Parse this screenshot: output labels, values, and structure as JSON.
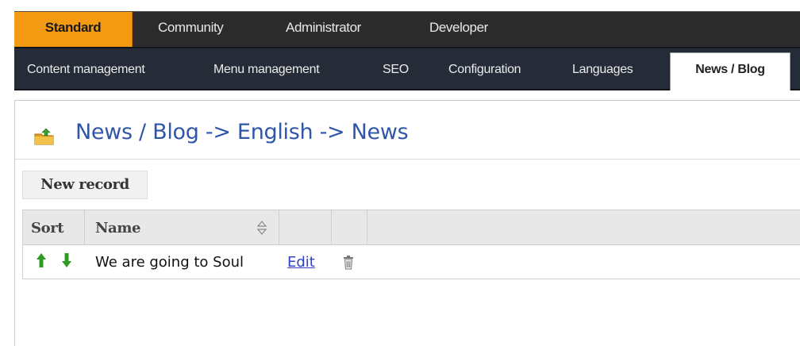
{
  "top_nav": {
    "tabs": [
      {
        "label": "Standard",
        "active": true
      },
      {
        "label": "Community",
        "active": false
      },
      {
        "label": "Administrator",
        "active": false
      },
      {
        "label": "Developer",
        "active": false
      }
    ]
  },
  "sub_nav": {
    "tabs": [
      {
        "label": "Content management",
        "active": false
      },
      {
        "label": "Menu management",
        "active": false
      },
      {
        "label": "SEO",
        "active": false
      },
      {
        "label": "Configuration",
        "active": false
      },
      {
        "label": "Languages",
        "active": false
      },
      {
        "label": "News / Blog",
        "active": true
      }
    ]
  },
  "page": {
    "title": "News / Blog -> English -> News",
    "title_icon": "folder-up-icon"
  },
  "toolbar": {
    "new_record_label": "New record"
  },
  "grid": {
    "columns": [
      "Sort",
      "Name",
      "",
      ""
    ],
    "rows": [
      {
        "name": "We are going to Soul",
        "edit_label": "Edit",
        "move_up_icon": "arrow-up-icon",
        "move_down_icon": "arrow-down-icon",
        "delete_icon": "trash-icon"
      }
    ]
  },
  "colors": {
    "active_top_tab": "#f39a12",
    "top_nav_bg": "#2b2b2b",
    "sub_nav_bg": "#262c37",
    "title_color": "#2f56a8",
    "link_color": "#2f40c0",
    "arrow_color": "#2e9c1f"
  }
}
